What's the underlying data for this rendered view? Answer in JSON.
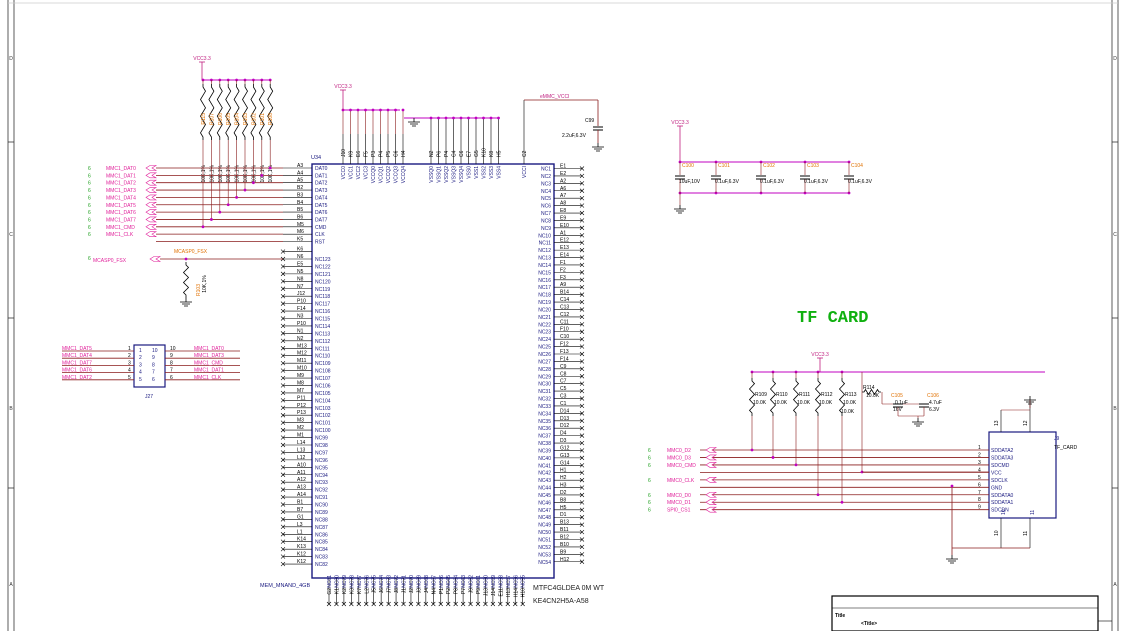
{
  "colors": {
    "wire": "#8a1c1c",
    "net_label": "#e0209a",
    "pin_text": "#1a1a80",
    "title": "#10b010",
    "vcc": "#c02080",
    "orange": "#e07000",
    "green": "#20a020",
    "pin_dot": "#c000c0"
  },
  "frame": {
    "row_markers": [
      "D",
      "C",
      "B",
      "A"
    ]
  },
  "u34": {
    "ref": "U34",
    "part": "MTFC4GLDEA 0M WT",
    "part2": "KE4CN2H5A-A58",
    "footprint": "MEM_MNAND_4GB",
    "left_pins": [
      {
        "ball": "A3",
        "name": "DAT0"
      },
      {
        "ball": "A4",
        "name": "DAT1"
      },
      {
        "ball": "A5",
        "name": "DAT2"
      },
      {
        "ball": "B2",
        "name": "DAT3"
      },
      {
        "ball": "B3",
        "name": "DAT4"
      },
      {
        "ball": "B4",
        "name": "DAT5"
      },
      {
        "ball": "B5",
        "name": "DAT6"
      },
      {
        "ball": "B6",
        "name": "DAT7"
      },
      {
        "ball": "M5",
        "name": "CMD"
      },
      {
        "ball": "M6",
        "name": "CLK"
      },
      {
        "ball": "K5",
        "name": "RST"
      }
    ],
    "left_nc": [
      {
        "ball": "K6",
        "name": ""
      },
      {
        "ball": "N6",
        "name": "NC123"
      },
      {
        "ball": "E5",
        "name": "NC122"
      },
      {
        "ball": "N5",
        "name": "NC121"
      },
      {
        "ball": "N8",
        "name": "NC120"
      },
      {
        "ball": "N7",
        "name": "NC119"
      },
      {
        "ball": "J12",
        "name": "NC118"
      },
      {
        "ball": "P10",
        "name": "NC117"
      },
      {
        "ball": "F14",
        "name": "NC116"
      },
      {
        "ball": "N3",
        "name": "NC115"
      },
      {
        "ball": "P10",
        "name": "NC114"
      },
      {
        "ball": "N1",
        "name": "NC113"
      },
      {
        "ball": "N2",
        "name": "NC112"
      },
      {
        "ball": "M13",
        "name": "NC111"
      },
      {
        "ball": "M12",
        "name": "NC110"
      },
      {
        "ball": "M11",
        "name": "NC109"
      },
      {
        "ball": "M10",
        "name": "NC108"
      },
      {
        "ball": "M9",
        "name": "NC107"
      },
      {
        "ball": "M8",
        "name": "NC106"
      },
      {
        "ball": "M7",
        "name": "NC105"
      },
      {
        "ball": "P11",
        "name": "NC104"
      },
      {
        "ball": "P12",
        "name": "NC103"
      },
      {
        "ball": "P13",
        "name": "NC102"
      },
      {
        "ball": "M3",
        "name": "NC101"
      },
      {
        "ball": "M2",
        "name": "NC100"
      },
      {
        "ball": "M1",
        "name": "NC99"
      },
      {
        "ball": "L14",
        "name": "NC98"
      },
      {
        "ball": "L13",
        "name": "NC97"
      },
      {
        "ball": "L12",
        "name": "NC96"
      },
      {
        "ball": "A10",
        "name": "NC95"
      },
      {
        "ball": "A11",
        "name": "NC94"
      },
      {
        "ball": "A12",
        "name": "NC93"
      },
      {
        "ball": "A13",
        "name": "NC92"
      },
      {
        "ball": "A14",
        "name": "NC91"
      },
      {
        "ball": "B1",
        "name": "NC90"
      },
      {
        "ball": "B7",
        "name": "NC89"
      },
      {
        "ball": "G1",
        "name": "NC88"
      },
      {
        "ball": "L3",
        "name": "NC87"
      },
      {
        "ball": "L1",
        "name": "NC86"
      },
      {
        "ball": "K14",
        "name": "NC85"
      },
      {
        "ball": "K13",
        "name": "NC84"
      },
      {
        "ball": "K12",
        "name": "NC83"
      },
      {
        "ball": "K12",
        "name": "NC82"
      }
    ],
    "right_pins": [
      {
        "ball": "E1",
        "name": "NC1"
      },
      {
        "ball": "E2",
        "name": "NC2"
      },
      {
        "ball": "A2",
        "name": "NC3"
      },
      {
        "ball": "A6",
        "name": "NC4"
      },
      {
        "ball": "A7",
        "name": "NC5"
      },
      {
        "ball": "A8",
        "name": "NC6"
      },
      {
        "ball": "E8",
        "name": "NC7"
      },
      {
        "ball": "E9",
        "name": "NC8"
      },
      {
        "ball": "E10",
        "name": "NC9"
      },
      {
        "ball": "A1",
        "name": "NC10"
      },
      {
        "ball": "E12",
        "name": "NC11"
      },
      {
        "ball": "E13",
        "name": "NC12"
      },
      {
        "ball": "E14",
        "name": "NC13"
      },
      {
        "ball": "F1",
        "name": "NC14"
      },
      {
        "ball": "F2",
        "name": "NC15"
      },
      {
        "ball": "F3",
        "name": "NC16"
      },
      {
        "ball": "A9",
        "name": "NC17"
      },
      {
        "ball": "B14",
        "name": "NC18"
      },
      {
        "ball": "C14",
        "name": "NC19"
      },
      {
        "ball": "C13",
        "name": "NC20"
      },
      {
        "ball": "C12",
        "name": "NC21"
      },
      {
        "ball": "C11",
        "name": "NC22"
      },
      {
        "ball": "F10",
        "name": "NC23"
      },
      {
        "ball": "C10",
        "name": "NC24"
      },
      {
        "ball": "F12",
        "name": "NC25"
      },
      {
        "ball": "F13",
        "name": "NC26"
      },
      {
        "ball": "F14",
        "name": "NC27"
      },
      {
        "ball": "C9",
        "name": "NC28"
      },
      {
        "ball": "C8",
        "name": "NC29"
      },
      {
        "ball": "C7",
        "name": "NC30"
      },
      {
        "ball": "C5",
        "name": "NC31"
      },
      {
        "ball": "C3",
        "name": "NC32"
      },
      {
        "ball": "C1",
        "name": "NC33"
      },
      {
        "ball": "D14",
        "name": "NC34"
      },
      {
        "ball": "D13",
        "name": "NC35"
      },
      {
        "ball": "D12",
        "name": "NC36"
      },
      {
        "ball": "D4",
        "name": "NC37"
      },
      {
        "ball": "D3",
        "name": "NC38"
      },
      {
        "ball": "G12",
        "name": "NC39"
      },
      {
        "ball": "G13",
        "name": "NC40"
      },
      {
        "ball": "G14",
        "name": "NC41"
      },
      {
        "ball": "H1",
        "name": "NC42"
      },
      {
        "ball": "H2",
        "name": "NC43"
      },
      {
        "ball": "H3",
        "name": "NC44"
      },
      {
        "ball": "D2",
        "name": "NC45"
      },
      {
        "ball": "B8",
        "name": "NC46"
      },
      {
        "ball": "H5",
        "name": "NC47"
      },
      {
        "ball": "D1",
        "name": "NC48"
      },
      {
        "ball": "B13",
        "name": "NC49"
      },
      {
        "ball": "B11",
        "name": "NC50"
      },
      {
        "ball": "B12",
        "name": "NC51"
      },
      {
        "ball": "B10",
        "name": "NC52"
      },
      {
        "ball": "B9",
        "name": "NC53"
      },
      {
        "ball": "H12",
        "name": "NC54"
      }
    ],
    "top_power": [
      {
        "ball": "J10",
        "name": "VCC0"
      },
      {
        "ball": "K9",
        "name": "VCC1"
      },
      {
        "ball": "E6",
        "name": "VCC2"
      },
      {
        "ball": "F5",
        "name": "VCC3"
      },
      {
        "ball": "P3",
        "name": "VCCQ0"
      },
      {
        "ball": "P4",
        "name": "VCCQ1"
      },
      {
        "ball": "P5",
        "name": "VCCQ2"
      },
      {
        "ball": "C6",
        "name": "VCCQ3"
      },
      {
        "ball": "H4",
        "name": "VCCQ4"
      }
    ],
    "top_gnd": [
      {
        "ball": "N2",
        "name": "VSSQ0"
      },
      {
        "ball": "P6",
        "name": "VSSQ1"
      },
      {
        "ball": "P4",
        "name": "VSSQ2"
      },
      {
        "ball": "C4",
        "name": "VSSQ3"
      },
      {
        "ball": "C6",
        "name": "VSSQ4"
      },
      {
        "ball": "E7",
        "name": "VSS0"
      },
      {
        "ball": "G5",
        "name": "VSS1"
      },
      {
        "ball": "K10",
        "name": "VSS2"
      },
      {
        "ball": "K8",
        "name": "VSS3"
      },
      {
        "ball": "H5",
        "name": "VSS4"
      }
    ],
    "top_vccq": {
      "ball": "C2",
      "name": "VCCI"
    },
    "bottom_nc": [
      {
        "ball": "G2",
        "name": "NC81"
      },
      {
        "ball": "K1",
        "name": "NC80"
      },
      {
        "ball": "K2",
        "name": "NC79"
      },
      {
        "ball": "K3",
        "name": "NC78"
      },
      {
        "ball": "K7",
        "name": "NC77"
      },
      {
        "ball": "L2",
        "name": "NC76"
      },
      {
        "ball": "J5",
        "name": "NC75"
      },
      {
        "ball": "J6",
        "name": "NC74"
      },
      {
        "ball": "J7",
        "name": "NC73"
      },
      {
        "ball": "J8",
        "name": "NC72"
      },
      {
        "ball": "J1",
        "name": "NC71"
      },
      {
        "ball": "J2",
        "name": "NC70"
      },
      {
        "ball": "J3",
        "name": "NC69"
      },
      {
        "ball": "J4",
        "name": "NC68"
      },
      {
        "ball": "N4",
        "name": "NC67"
      },
      {
        "ball": "P1",
        "name": "NC66"
      },
      {
        "ball": "P2",
        "name": "NC65"
      },
      {
        "ball": "P8",
        "name": "NC64"
      },
      {
        "ball": "P7",
        "name": "NC63"
      },
      {
        "ball": "J9",
        "name": "NC62"
      },
      {
        "ball": "P9",
        "name": "NC61"
      },
      {
        "ball": "J13",
        "name": "NC60"
      },
      {
        "ball": "J14",
        "name": "NC59"
      },
      {
        "ball": "E11",
        "name": "NC58"
      },
      {
        "ball": "H13",
        "name": "NC57"
      },
      {
        "ball": "H14",
        "name": "NC56"
      },
      {
        "ball": "H10",
        "name": "NC55"
      }
    ]
  },
  "nets_left": [
    "MMC1_DAT0",
    "MMC1_DAT1",
    "MMC1_DAT2",
    "MMC1_DAT3",
    "MMC1_DAT4",
    "MMC1_DAT5",
    "MMC1_DAT6",
    "MMC1_DAT7",
    "MMC1_CMD",
    "MMC1_CLK"
  ],
  "net_sheet_ref": "6",
  "mcasp": {
    "ref": "6",
    "net": "MCASP0_FSX",
    "label": "MCASP0_FSX",
    "res": "R103",
    "val": "10K,1%"
  },
  "pullups": {
    "rail": "VCC3.3",
    "refs": [
      "R115",
      "R107",
      "R106",
      "R105",
      "R104",
      "R103",
      "R102",
      "R101",
      "R108"
    ],
    "values": [
      "10K,1%",
      "10K,1%",
      "10K,1%",
      "10K,1%",
      "10K,1%",
      "10K,1%",
      "10K,1%",
      "10K,1%",
      "10K,1%"
    ]
  },
  "vcc_labels": {
    "pullup": "VCC3.3",
    "chip": "VCC3.3",
    "emmc": "eMMC_VCCI",
    "decap": "VCC3.3",
    "tf": "VCC3.3"
  },
  "c99": {
    "ref": "C99",
    "val": "2.2uF,6.3V"
  },
  "decaps": [
    {
      "ref": "C100",
      "val": "10uF,10V"
    },
    {
      "ref": "C101",
      "val": "0.1uF,6.3V"
    },
    {
      "ref": "C102",
      "val": "0.1uF,6.3V"
    },
    {
      "ref": "C103",
      "val": "0.1uF,6.3V"
    },
    {
      "ref": "C104",
      "val": "0.1uF,6.3V"
    }
  ],
  "j27": {
    "ref": "J27",
    "left_nets": [
      "MMC1_DAT5",
      "MMC1_DAT4",
      "MMC1_DAT7",
      "MMC1_DAT6",
      "MMC1_DAT2"
    ],
    "left_pins": [
      "1",
      "2",
      "3",
      "4",
      "5"
    ],
    "inner_left": [
      "1",
      "2",
      "3",
      "4",
      "5"
    ],
    "inner_right": [
      "10",
      "9",
      "8",
      "7",
      "6"
    ],
    "right_pins": [
      "10",
      "9",
      "8",
      "7",
      "6"
    ],
    "right_nets": [
      "MMC1_DAT0",
      "MMC1_DAT3",
      "MMC1_CMD",
      "MMC1_DAT1",
      "MMC1_CLK"
    ]
  },
  "tf": {
    "title": "TF CARD",
    "ref": "J9",
    "part": "TF_CARD",
    "pins": [
      {
        "num": "1",
        "name": "SDDATA2"
      },
      {
        "num": "2",
        "name": "SDDATA3"
      },
      {
        "num": "3",
        "name": "SDCMD"
      },
      {
        "num": "4",
        "name": "VCC"
      },
      {
        "num": "5",
        "name": "SDCLK"
      },
      {
        "num": "6",
        "name": "GND"
      },
      {
        "num": "7",
        "name": "SDDATA0"
      },
      {
        "num": "8",
        "name": "SDDATA1"
      },
      {
        "num": "9",
        "name": "SDCDN"
      }
    ],
    "top_pins": [
      "13",
      "12"
    ],
    "bottom_pins": [
      "10",
      "11"
    ],
    "inner_bottom": [
      "10",
      "11"
    ],
    "nets": [
      {
        "ref": "6",
        "net": "MMC0_D2"
      },
      {
        "ref": "6",
        "net": "MMC0_D3"
      },
      {
        "ref": "6",
        "net": "MMC0_CMD"
      },
      {
        "ref": "6",
        "net": "MMC0_CLK"
      },
      {
        "ref": "6",
        "net": "MMC0_D0"
      },
      {
        "ref": "6",
        "net": "MMC0_D1"
      },
      {
        "ref": "6",
        "net": "SPI0_CS1"
      }
    ],
    "resistors": [
      {
        "ref": "R109",
        "val": "10.0K"
      },
      {
        "ref": "R110",
        "val": "10.0K"
      },
      {
        "ref": "R111",
        "val": "10.0K"
      },
      {
        "ref": "R112",
        "val": "10.0K"
      },
      {
        "ref": "R113",
        "val": "10.0K"
      },
      {
        "ref": "R114",
        "val": "10.0K"
      }
    ],
    "c105": {
      "ref": "C105",
      "val": "0.1uF",
      "v": "16V"
    },
    "c106": {
      "ref": "C106",
      "val": "4.7uF",
      "v": "6.3V"
    }
  },
  "title_block": {
    "label": "Title",
    "value": "<Title>"
  }
}
